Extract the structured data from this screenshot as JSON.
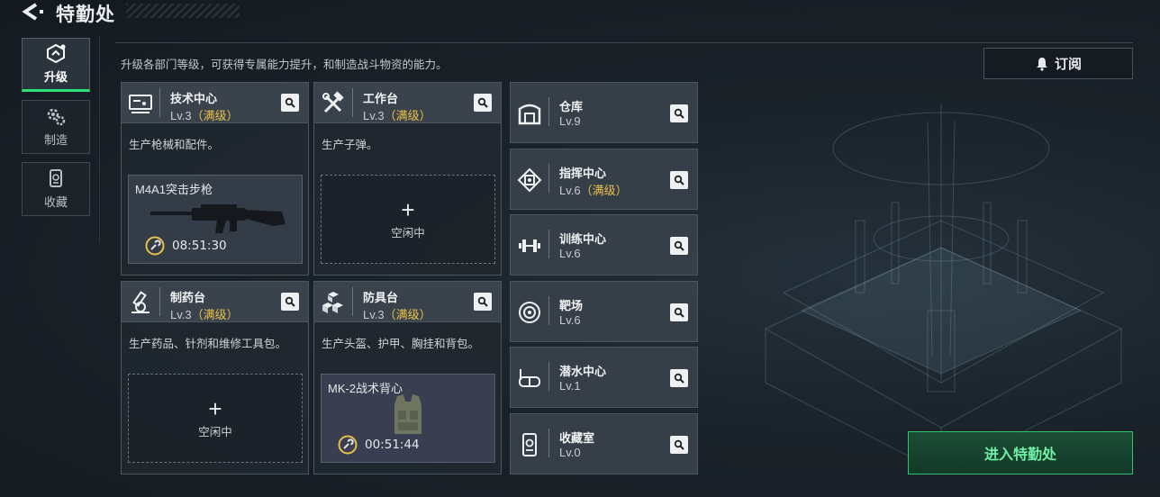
{
  "header": {
    "title": "特勤处"
  },
  "description": "升级各部门等级，可获得专属能力提升，和制造战斗物资的能力。",
  "subscribe": {
    "label": "订阅",
    "icon": "bell-icon"
  },
  "nav": [
    {
      "label": "升级",
      "icon": "upgrade-icon",
      "active": true
    },
    {
      "label": "制造",
      "icon": "gears-icon",
      "active": false
    },
    {
      "label": "收藏",
      "icon": "collection-icon",
      "active": false
    }
  ],
  "cards": [
    {
      "name": "技术中心",
      "level": "Lv.3",
      "max": "（满级）",
      "icon": "tech-center-icon",
      "desc": "生产枪械和配件。",
      "slot": {
        "state": "filled",
        "item": "M4A1突击步枪",
        "timer": "08:51:30"
      }
    },
    {
      "name": "工作台",
      "level": "Lv.3",
      "max": "（满级）",
      "icon": "workbench-icon",
      "desc": "生产子弹。",
      "slot": {
        "state": "empty",
        "idle": "空闲中"
      }
    },
    {
      "name": "制药台",
      "level": "Lv.3",
      "max": "（满级）",
      "icon": "pharmacy-icon",
      "desc": "生产药品、针剂和维修工具包。",
      "slot": {
        "state": "empty",
        "idle": "空闲中"
      }
    },
    {
      "name": "防具台",
      "level": "Lv.3",
      "max": "（满级）",
      "icon": "armor-bench-icon",
      "desc": "生产头盔、护甲、胸挂和背包。",
      "slot": {
        "state": "filled",
        "item": "MK-2战术背心",
        "timer": "00:51:44"
      }
    }
  ],
  "facilities": [
    {
      "name": "仓库",
      "level": "Lv.9",
      "max": "",
      "icon": "warehouse-icon"
    },
    {
      "name": "指挥中心",
      "level": "Lv.6",
      "max": "（满级）",
      "icon": "command-center-icon"
    },
    {
      "name": "训练中心",
      "level": "Lv.6",
      "max": "",
      "icon": "dumbbell-icon"
    },
    {
      "name": "靶场",
      "level": "Lv.6",
      "max": "",
      "icon": "target-icon"
    },
    {
      "name": "潜水中心",
      "level": "Lv.1",
      "max": "",
      "icon": "diving-mask-icon"
    },
    {
      "name": "收藏室",
      "level": "Lv.0",
      "max": "",
      "icon": "collection-room-icon"
    }
  ],
  "enter_button": "进入特勤处",
  "colors": {
    "accent_green": "#2ee07a",
    "max_level_gold": "#e7c04a"
  }
}
